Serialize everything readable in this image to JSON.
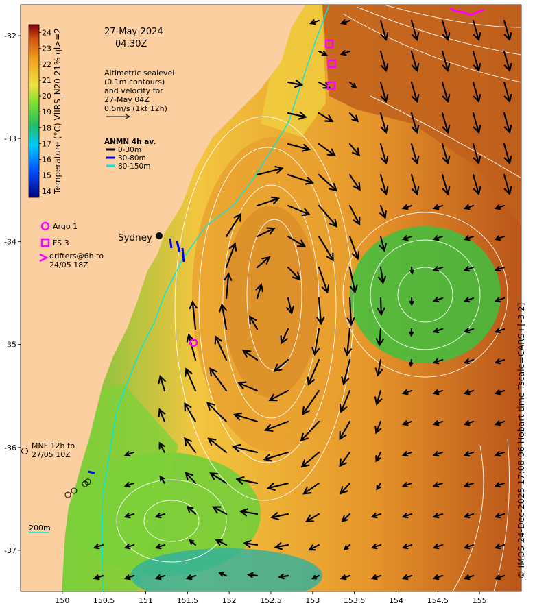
{
  "datetime": {
    "date": "27-May-2024",
    "time": "04:30Z"
  },
  "altimetry_note": [
    "Altimetric sealevel",
    "(0.1m contours)",
    "and velocity for",
    "27-May 04Z",
    "0.5m/s (1kt 12h)"
  ],
  "anmn_legend": {
    "title": "ANMN 4h av.",
    "items": [
      {
        "label": "0-30m",
        "color": "#000000"
      },
      {
        "label": "30-80m",
        "color": "#0000ff"
      },
      {
        "label": "80-150m",
        "color": "#00e5e5"
      }
    ]
  },
  "colorbar": {
    "label": "Temperature (°C) VIIRS_N20 21% ql>=2",
    "ticks": [
      "24",
      "23",
      "22",
      "21",
      "20",
      "19",
      "18",
      "17",
      "16",
      "15",
      "14"
    ],
    "min": 13.6,
    "max": 24.5
  },
  "platform_legend": {
    "argo": "Argo 1",
    "fs": "FS 3",
    "drifters": [
      "drifters@6h to",
      "24/05 18Z"
    ],
    "mnf": [
      "MNF 12h to",
      "27/05 10Z"
    ]
  },
  "place_label": "Sydney",
  "depth_label": "200m",
  "axes": {
    "x_ticks": [
      "150",
      "150.5",
      "151",
      "151.5",
      "152",
      "152.5",
      "153",
      "153.5",
      "154",
      "154.5",
      "155"
    ],
    "y_ticks": [
      "-32",
      "-33",
      "-34",
      "-35",
      "-36",
      "-37"
    ],
    "lon_range": [
      149.5,
      155.5
    ],
    "lat_range": [
      -37.4,
      -31.7
    ]
  },
  "copyright": "© IMOS 24-Dec-2025 17:08:06 Hobart time Tscale=CARS+[-3 2]",
  "colors": {
    "land": "#fbcfa0",
    "contour": "#ffffff",
    "argo": "#ff00ff",
    "shelf": "#00e5e5"
  }
}
